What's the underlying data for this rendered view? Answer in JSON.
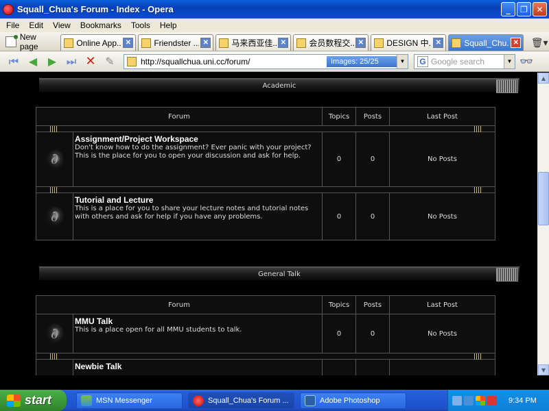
{
  "window": {
    "title": "Squall_Chua's Forum - Index - Opera"
  },
  "menu": [
    "File",
    "Edit",
    "View",
    "Bookmarks",
    "Tools",
    "Help"
  ],
  "tabs": {
    "new_page": "New page",
    "items": [
      {
        "label": "Online App..."
      },
      {
        "label": "Friendster ..."
      },
      {
        "label": "马来西亚佳..."
      },
      {
        "label": "会员数程交..."
      },
      {
        "label": "DESIGN 中...."
      },
      {
        "label": "Squall_Chu..."
      }
    ]
  },
  "address": {
    "url": "http://squallchua.uni.cc/forum/",
    "images": "Images:   25/25",
    "search_placeholder": "Google search"
  },
  "categories": [
    {
      "name": "Academic",
      "headers": {
        "forum": "Forum",
        "topics": "Topics",
        "posts": "Posts",
        "last_post": "Last Post"
      },
      "forums": [
        {
          "name": "Assignment/Project Workspace",
          "description": "Don't know how to do the assignment? Ever panic with your project? This is the place for you to open your discussion and ask for help.",
          "topics": "0",
          "posts": "0",
          "last_post": "No Posts"
        },
        {
          "name": "Tutorial and Lecture",
          "description": "This is a place for you to share your lecture notes and tutorial notes with others and ask for help if you have any problems.",
          "topics": "0",
          "posts": "0",
          "last_post": "No Posts"
        }
      ]
    },
    {
      "name": "General Talk",
      "headers": {
        "forum": "Forum",
        "topics": "Topics",
        "posts": "Posts",
        "last_post": "Last Post"
      },
      "forums": [
        {
          "name": "MMU Talk",
          "description": "This is a place open for all MMU students to talk.",
          "topics": "0",
          "posts": "0",
          "last_post": "No Posts"
        },
        {
          "name": "Newbie Talk",
          "description": "",
          "topics": "",
          "posts": "",
          "last_post": ""
        }
      ]
    }
  ],
  "taskbar": {
    "start": "start",
    "tasks": [
      {
        "label": "MSN Messenger"
      },
      {
        "label": "Squall_Chua's Forum ..."
      },
      {
        "label": "Adobe Photoshop"
      }
    ],
    "clock": "9:34 PM"
  }
}
